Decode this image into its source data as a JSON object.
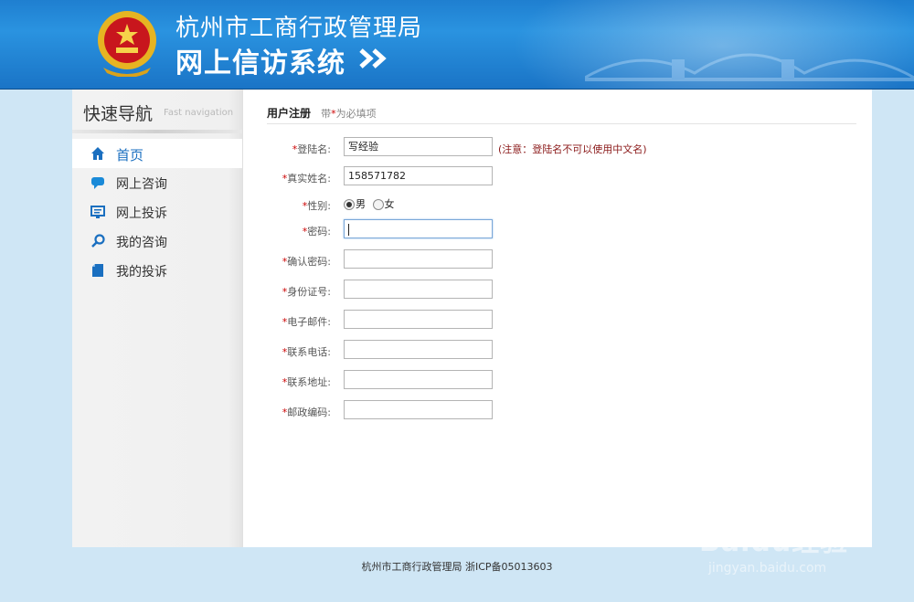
{
  "header": {
    "title_line1": "杭州市工商行政管理局",
    "title_line2": "网上信访系统",
    "emblem_icon": "national-emblem-icon",
    "colors": {
      "primary": "#1f7fd0",
      "dark": "#1a74c6"
    }
  },
  "sidebar": {
    "title": "快速导航",
    "subtitle": "Fast navigation",
    "items": [
      {
        "label": "首页",
        "icon": "home-icon",
        "active": true
      },
      {
        "label": "网上咨询",
        "icon": "chat-bubble-icon",
        "active": false
      },
      {
        "label": "网上投诉",
        "icon": "monitor-icon",
        "active": false
      },
      {
        "label": "我的咨询",
        "icon": "magnifier-icon",
        "active": false
      },
      {
        "label": "我的投诉",
        "icon": "document-icon",
        "active": false
      }
    ]
  },
  "form": {
    "heading": "用户注册",
    "required_note_pre": "带",
    "required_note_star": "*",
    "required_note_post": "为必填项",
    "fields": [
      {
        "label": "登陆名:",
        "value": "写经验",
        "note": "(注意：登陆名不可以使用中文名)"
      },
      {
        "label": "真实姓名:",
        "value": "158571782"
      },
      {
        "label": "性别:",
        "options": [
          "男",
          "女"
        ],
        "selected": "男"
      },
      {
        "label": "密码:",
        "value": ""
      },
      {
        "label": "确认密码:",
        "value": ""
      },
      {
        "label": "身份证号:",
        "value": ""
      },
      {
        "label": "电子邮件:",
        "value": ""
      },
      {
        "label": "联系电话:",
        "value": ""
      },
      {
        "label": "联系地址:",
        "value": ""
      },
      {
        "label": "邮政编码:",
        "value": ""
      }
    ],
    "required_mark": "*"
  },
  "footer": {
    "text": "杭州市工商行政管理局 浙ICP备05013603"
  },
  "watermark": {
    "brand": "Baidu经验",
    "url": "jingyan.baidu.com"
  }
}
